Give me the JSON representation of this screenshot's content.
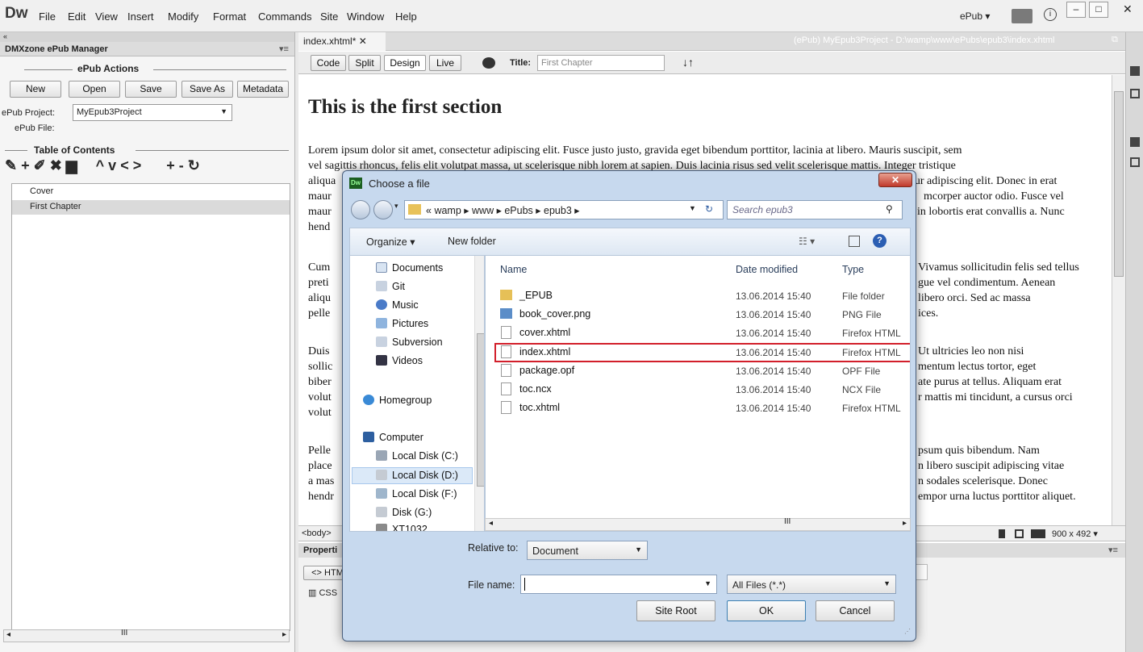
{
  "app": {
    "logo": "Dw",
    "menus": [
      "File",
      "Edit",
      "View",
      "Insert",
      "Modify",
      "Format",
      "Commands",
      "Site",
      "Window",
      "Help"
    ],
    "workspace": "ePub"
  },
  "panel": {
    "title": "DMXzone ePub Manager",
    "actions_title": "ePub Actions",
    "buttons": [
      "New",
      "Open",
      "Save",
      "Save As",
      "Metadata"
    ],
    "project_label": "ePub Project:",
    "project_value": "MyEpub3Project",
    "file_label": "ePub File:",
    "toc_title": "Table of Contents",
    "toc_items": [
      "Cover",
      "First Chapter"
    ]
  },
  "document": {
    "tab": "index.xhtml*",
    "path": "(ePub) MyEpub3Project - D:\\wamp\\www\\ePubs\\epub3\\index.xhtml",
    "view_buttons": [
      "Code",
      "Split",
      "Design",
      "Live"
    ],
    "title_label": "Title:",
    "title_value": "First Chapter",
    "heading": "This is the first section",
    "para1": [
      "Lorem ipsum dolor sit amet, consectetur adipiscing elit. Fusce justo justo, gravida eget bibendum porttitor, lacinia at libero. Mauris suscipit, sem",
      "vel sagittis rhoncus, felis elit volutpat massa, ut scelerisque nibh lorem at sapien. Duis lacinia risus sed velit scelerisque mattis. Integer tristique",
      "aliqua",
      "maur",
      "maur",
      "hend"
    ],
    "para1_right": [
      "tur adipiscing elit. Donec in erat",
      "mcorper auctor odio. Fusce vel",
      ", in lobortis erat convallis a. Nunc"
    ],
    "para2_left": [
      "Cum",
      "preti",
      "aliqu",
      "pelle"
    ],
    "para2_right": [
      "Vivamus sollicitudin felis sed tellus",
      "gue vel condimentum. Aenean",
      "libero orci. Sed ac massa",
      "ices."
    ],
    "para3_left": [
      "Duis",
      "sollic",
      "biber",
      "volut",
      "volut"
    ],
    "para3_right": [
      "Ut ultricies leo non nisi",
      "mentum lectus tortor, eget",
      "ate purus at tellus. Aliquam erat",
      "r mattis mi tincidunt, a cursus orci"
    ],
    "para4_left": [
      "Pelle",
      "place",
      "a mas",
      "hendr"
    ],
    "para4_right": [
      "psum quis bibendum. Nam",
      "n libero suscipit adipiscing vitae",
      "n sodales scelerisque. Donec",
      "empor urna luctus porttitor aliquet."
    ],
    "status_tag": "<body>",
    "window_size": "900 x 492",
    "properties": "Properti",
    "html_btn": "<> HTM",
    "css_btn": "CSS"
  },
  "dialog": {
    "title": "Choose a file",
    "breadcrumb": [
      "«",
      "wamp",
      "www",
      "ePubs",
      "epub3"
    ],
    "search_placeholder": "Search epub3",
    "organize": "Organize",
    "new_folder": "New folder",
    "nav": [
      "Documents",
      "Git",
      "Music",
      "Pictures",
      "Subversion",
      "Videos",
      "Homegroup",
      "Computer",
      "Local Disk (C:)",
      "Local Disk (D:)",
      "Local Disk (F:)",
      "Disk (G:)",
      "XT1032"
    ],
    "columns": [
      "Name",
      "Date modified",
      "Type"
    ],
    "files": [
      {
        "name": "_EPUB",
        "date": "13.06.2014 15:40",
        "type": "File folder"
      },
      {
        "name": "book_cover.png",
        "date": "13.06.2014 15:40",
        "type": "PNG File"
      },
      {
        "name": "cover.xhtml",
        "date": "13.06.2014 15:40",
        "type": "Firefox HTML"
      },
      {
        "name": "index.xhtml",
        "date": "13.06.2014 15:40",
        "type": "Firefox HTML"
      },
      {
        "name": "package.opf",
        "date": "13.06.2014 15:40",
        "type": "OPF File"
      },
      {
        "name": "toc.ncx",
        "date": "13.06.2014 15:40",
        "type": "NCX File"
      },
      {
        "name": "toc.xhtml",
        "date": "13.06.2014 15:40",
        "type": "Firefox HTML"
      }
    ],
    "relative_label": "Relative to:",
    "relative_value": "Document",
    "filename_label": "File name:",
    "filetype_value": "All Files (*.*)",
    "buttons": {
      "site_root": "Site Root",
      "ok": "OK",
      "cancel": "Cancel"
    }
  },
  "colors": {
    "selection_border": "#d21f2b",
    "dialog_frame": "#c7d9ee"
  }
}
